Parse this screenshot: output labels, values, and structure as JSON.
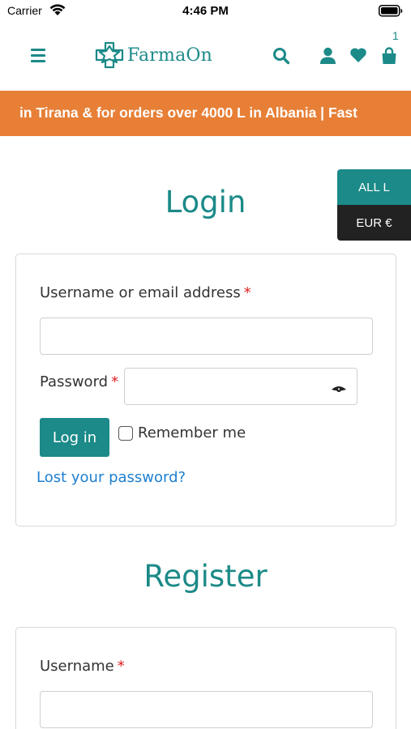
{
  "status_bar": {
    "carrier": "Carrier",
    "time": "4:46 PM"
  },
  "header": {
    "logo_text": "FarmaOn",
    "cart_count": "1",
    "icons": [
      "menu-icon",
      "search-icon",
      "user-icon",
      "heart-icon",
      "cart-icon"
    ]
  },
  "banner": {
    "text": "in Tirana & for orders over 4000 L in Albania | Fast"
  },
  "currency": {
    "options": [
      "ALL L",
      "EUR €"
    ],
    "selected": "ALL L"
  },
  "login": {
    "title": "Login",
    "username_label": "Username or email address",
    "username_value": "",
    "password_label": "Password",
    "password_value": "",
    "required_mark": "*",
    "submit_label": "Log in",
    "remember_label": "Remember me",
    "remember_checked": false,
    "lost_password_label": "Lost your password?"
  },
  "register": {
    "title": "Register",
    "username_label": "Username",
    "username_value": "",
    "required_mark": "*"
  },
  "colors": {
    "brand": "#1b8a88",
    "banner": "#e77f36",
    "required": "#e02020",
    "link": "#1e7fd0",
    "currency_dark": "#222222"
  }
}
